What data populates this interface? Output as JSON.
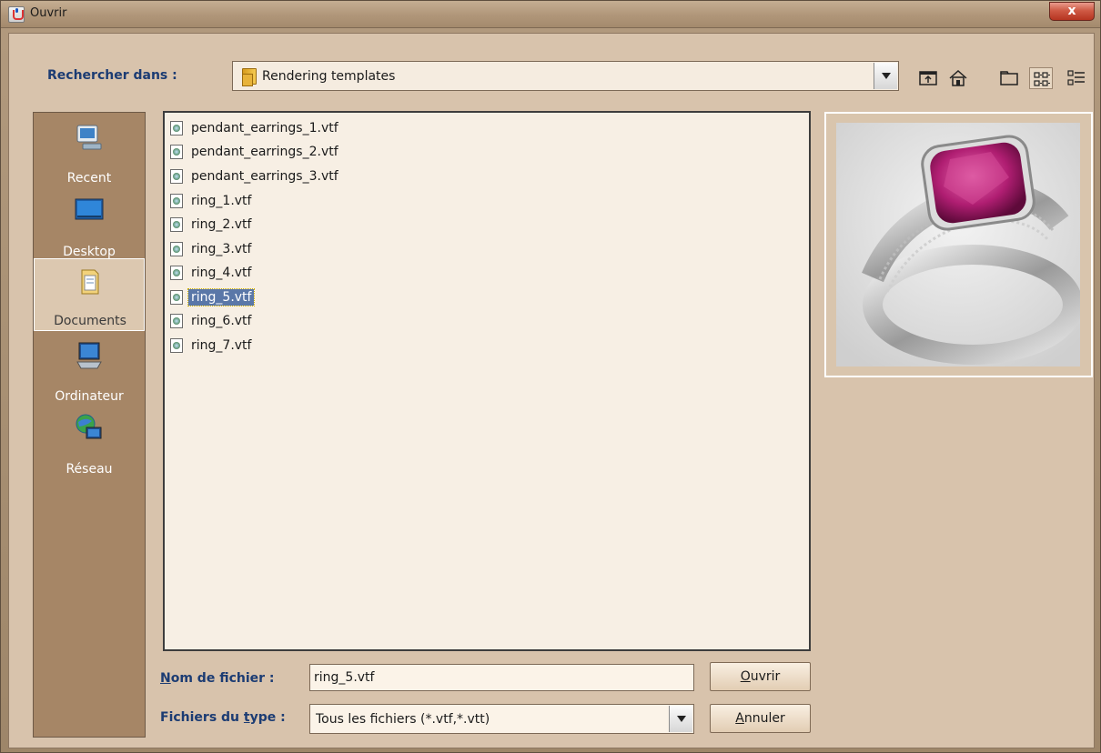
{
  "window": {
    "title": "Ouvrir",
    "close_label": "x"
  },
  "toolbar": {
    "look_in_label": "Rechercher dans :",
    "look_in_value": "Rendering templates",
    "buttons": [
      "up-folder-icon",
      "home-icon",
      "new-folder-icon",
      "list-view-icon",
      "details-view-icon"
    ]
  },
  "places": [
    {
      "label": "Recent",
      "icon": "recent-icon"
    },
    {
      "label": "Desktop",
      "icon": "desktop-icon"
    },
    {
      "label": "Documents",
      "icon": "documents-icon",
      "selected": true
    },
    {
      "label": "Ordinateur",
      "icon": "computer-icon"
    },
    {
      "label": "Réseau",
      "icon": "network-icon"
    }
  ],
  "files": [
    "pendant_earrings_1.vtf",
    "pendant_earrings_2.vtf",
    "pendant_earrings_3.vtf",
    "ring_1.vtf",
    "ring_2.vtf",
    "ring_3.vtf",
    "ring_4.vtf",
    "ring_5.vtf",
    "ring_6.vtf",
    "ring_7.vtf"
  ],
  "selected_file_index": 7,
  "bottom": {
    "filename_label_first": "N",
    "filename_label_rest": "om de fichier :",
    "filename_value": "ring_5.vtf",
    "filetype_label_a": "Fichiers du ",
    "filetype_label_t": "t",
    "filetype_label_b": "ype :",
    "filetype_value": "Tous les fichiers (*.vtf,*.vtt)",
    "open_first": "O",
    "open_rest": "uvrir",
    "cancel_first": "A",
    "cancel_rest": "nnuler"
  },
  "colors": {
    "accent_label": "#1c3c73",
    "selection": "#5a77a8"
  }
}
